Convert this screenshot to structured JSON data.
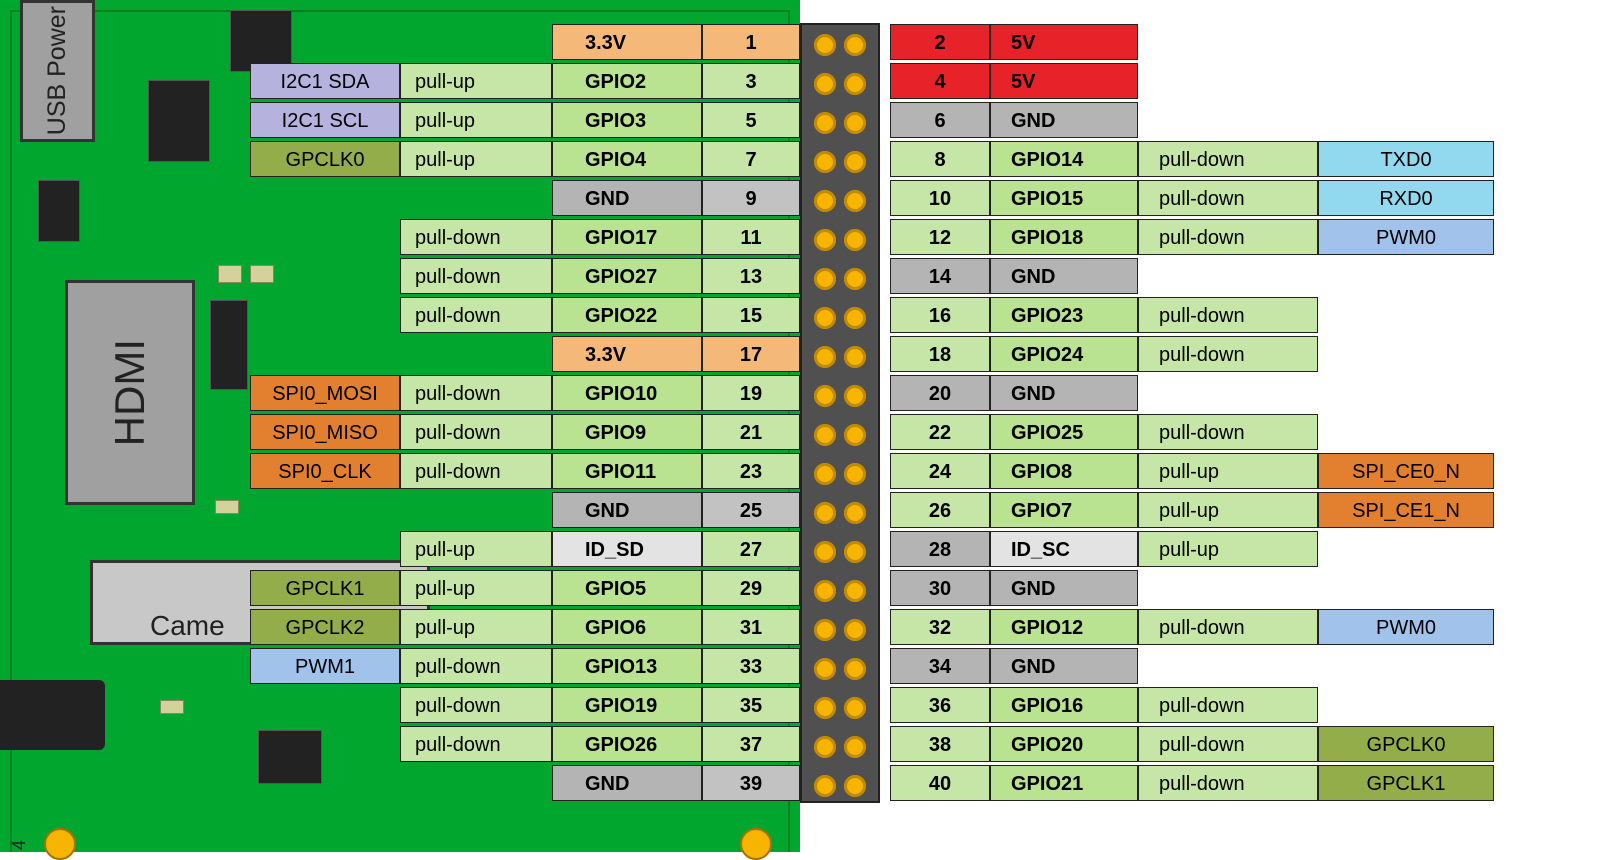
{
  "labels": {
    "usb_power": "USB\nPower",
    "hdmi": "HDMI",
    "camera": "Came",
    "bottom_num": "4"
  },
  "colors": {
    "gpio": "c-gpio",
    "gpio_b": "c-gpio-b",
    "v33": "c-3v3",
    "v5": "c-5v",
    "gnd": "c-gnd",
    "gnd_b": "c-gnd-b",
    "id": "c-id",
    "i2c": "c-i2c",
    "spi": "c-spi",
    "uart": "c-uart",
    "pwm": "c-pwm",
    "clk": "c-clk"
  },
  "rows": [
    {
      "left": {
        "num": "1",
        "name": "3.3V",
        "name_c": "v33"
      },
      "right": {
        "num": "2",
        "name": "5V",
        "num_c": "v5",
        "name_c": "v5"
      }
    },
    {
      "left": {
        "num": "3",
        "name": "GPIO2",
        "pull": "pull-up",
        "alt": "I2C1 SDA",
        "alt_c": "i2c"
      },
      "right": {
        "num": "4",
        "name": "5V",
        "num_c": "v5",
        "name_c": "v5"
      }
    },
    {
      "left": {
        "num": "5",
        "name": "GPIO3",
        "pull": "pull-up",
        "alt": "I2C1 SCL",
        "alt_c": "i2c"
      },
      "right": {
        "num": "6",
        "name": "GND",
        "num_c": "gnd",
        "name_c": "gnd"
      }
    },
    {
      "left": {
        "num": "7",
        "name": "GPIO4",
        "pull": "pull-up",
        "alt": "GPCLK0",
        "alt_c": "clk"
      },
      "right": {
        "num": "8",
        "name": "GPIO14",
        "pull": "pull-down",
        "alt": "TXD0",
        "alt_c": "uart"
      }
    },
    {
      "left": {
        "num": "9",
        "name": "GND",
        "name_c": "gnd"
      },
      "right": {
        "num": "10",
        "name": "GPIO15",
        "pull": "pull-down",
        "alt": "RXD0",
        "alt_c": "uart"
      }
    },
    {
      "left": {
        "num": "11",
        "name": "GPIO17",
        "pull": "pull-down"
      },
      "right": {
        "num": "12",
        "name": "GPIO18",
        "pull": "pull-down",
        "alt": "PWM0",
        "alt_c": "pwm"
      }
    },
    {
      "left": {
        "num": "13",
        "name": "GPIO27",
        "pull": "pull-down"
      },
      "right": {
        "num": "14",
        "name": "GND",
        "num_c": "gnd",
        "name_c": "gnd"
      }
    },
    {
      "left": {
        "num": "15",
        "name": "GPIO22",
        "pull": "pull-down"
      },
      "right": {
        "num": "16",
        "name": "GPIO23",
        "pull": "pull-down"
      }
    },
    {
      "left": {
        "num": "17",
        "name": "3.3V",
        "name_c": "v33"
      },
      "right": {
        "num": "18",
        "name": "GPIO24",
        "pull": "pull-down"
      }
    },
    {
      "left": {
        "num": "19",
        "name": "GPIO10",
        "pull": "pull-down",
        "alt": "SPI0_MOSI",
        "alt_c": "spi"
      },
      "right": {
        "num": "20",
        "name": "GND",
        "num_c": "gnd",
        "name_c": "gnd"
      }
    },
    {
      "left": {
        "num": "21",
        "name": "GPIO9",
        "pull": "pull-down",
        "alt": "SPI0_MISO",
        "alt_c": "spi"
      },
      "right": {
        "num": "22",
        "name": "GPIO25",
        "pull": "pull-down"
      }
    },
    {
      "left": {
        "num": "23",
        "name": "GPIO11",
        "pull": "pull-down",
        "alt": "SPI0_CLK",
        "alt_c": "spi"
      },
      "right": {
        "num": "24",
        "name": "GPIO8",
        "pull": "pull-up",
        "alt": "SPI_CE0_N",
        "alt_c": "spi"
      }
    },
    {
      "left": {
        "num": "25",
        "name": "GND",
        "name_c": "gnd"
      },
      "right": {
        "num": "26",
        "name": "GPIO7",
        "pull": "pull-up",
        "alt": "SPI_CE1_N",
        "alt_c": "spi"
      }
    },
    {
      "left": {
        "num": "27",
        "name": "ID_SD",
        "name_c": "id",
        "pull": "pull-up"
      },
      "right": {
        "num": "28",
        "name": "ID_SC",
        "num_c": "gnd",
        "name_c": "id",
        "pull": "pull-up"
      }
    },
    {
      "left": {
        "num": "29",
        "name": "GPIO5",
        "pull": "pull-up",
        "alt": "GPCLK1",
        "alt_c": "clk"
      },
      "right": {
        "num": "30",
        "name": "GND",
        "num_c": "gnd",
        "name_c": "gnd"
      }
    },
    {
      "left": {
        "num": "31",
        "name": "GPIO6",
        "pull": "pull-up",
        "alt": "GPCLK2",
        "alt_c": "clk"
      },
      "right": {
        "num": "32",
        "name": "GPIO12",
        "pull": "pull-down",
        "alt": "PWM0",
        "alt_c": "pwm"
      }
    },
    {
      "left": {
        "num": "33",
        "name": "GPIO13",
        "pull": "pull-down",
        "alt": "PWM1",
        "alt_c": "pwm"
      },
      "right": {
        "num": "34",
        "name": "GND",
        "num_c": "gnd",
        "name_c": "gnd"
      }
    },
    {
      "left": {
        "num": "35",
        "name": "GPIO19",
        "pull": "pull-down"
      },
      "right": {
        "num": "36",
        "name": "GPIO16",
        "pull": "pull-down"
      }
    },
    {
      "left": {
        "num": "37",
        "name": "GPIO26",
        "pull": "pull-down"
      },
      "right": {
        "num": "38",
        "name": "GPIO20",
        "pull": "pull-down",
        "alt": "GPCLK0",
        "alt_c": "clk"
      }
    },
    {
      "left": {
        "num": "39",
        "name": "GND",
        "name_c": "gnd"
      },
      "right": {
        "num": "40",
        "name": "GPIO21",
        "pull": "pull-down",
        "alt": "GPCLK1",
        "alt_c": "clk"
      }
    }
  ]
}
